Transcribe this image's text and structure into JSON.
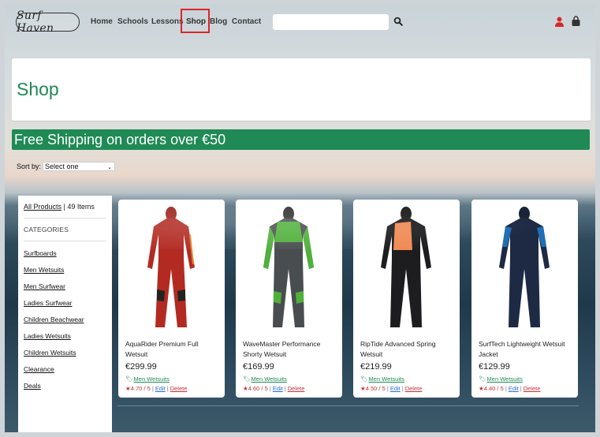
{
  "nav": {
    "logo": "Surf Haven",
    "links": [
      "Home",
      "Schools",
      "Lessons",
      "Shop",
      "Blog",
      "Contact"
    ],
    "active": "Shop",
    "search_placeholder": ""
  },
  "header": {
    "title": "Shop"
  },
  "banner": {
    "text": "Free Shipping on orders over €50"
  },
  "sort": {
    "label": "Sort by:",
    "selected": "Select one"
  },
  "sidebar": {
    "all_products": "All Products",
    "count_text": " | 49 Items",
    "categories_title": "CATEGORIES",
    "categories": [
      "Surfboards",
      "Men Wetsuits",
      "Men Surfwear",
      "Ladies Surfwear",
      "Children Beachwear",
      "Ladies Wetsuits",
      "Children Wetsuits",
      "Clearance",
      "Deals"
    ]
  },
  "products": [
    {
      "name": "AquaRider Premium Full Wetsuit",
      "price": "€299.99",
      "category": "Men Wetsuits",
      "rating": "4.70 / 5",
      "edit": "Edit",
      "delete": "Delete",
      "color": "#b22a22"
    },
    {
      "name": "WaveMaster Performance Shorty Wetsuit",
      "price": "€169.99",
      "category": "Men Wetsuits",
      "rating": "4.60 / 5",
      "edit": "Edit",
      "delete": "Delete",
      "color": "#4fb03a"
    },
    {
      "name": "RipTide Advanced Spring Wetsuit",
      "price": "€219.99",
      "category": "Men Wetsuits",
      "rating": "4.50 / 5",
      "edit": "Edit",
      "delete": "Delete",
      "color": "#f08a55"
    },
    {
      "name": "SurfTech Lightweight Wetsuit Jacket",
      "price": "€129.99",
      "category": "Men Wetsuits",
      "rating": "4.40 / 5",
      "edit": "Edit",
      "delete": "Delete",
      "color": "#1f6fb5"
    }
  ],
  "colors": {
    "accent": "#1f8a55",
    "active_outline": "#d9262c",
    "link": "#2a6fd1",
    "rating": "#c8323a"
  }
}
